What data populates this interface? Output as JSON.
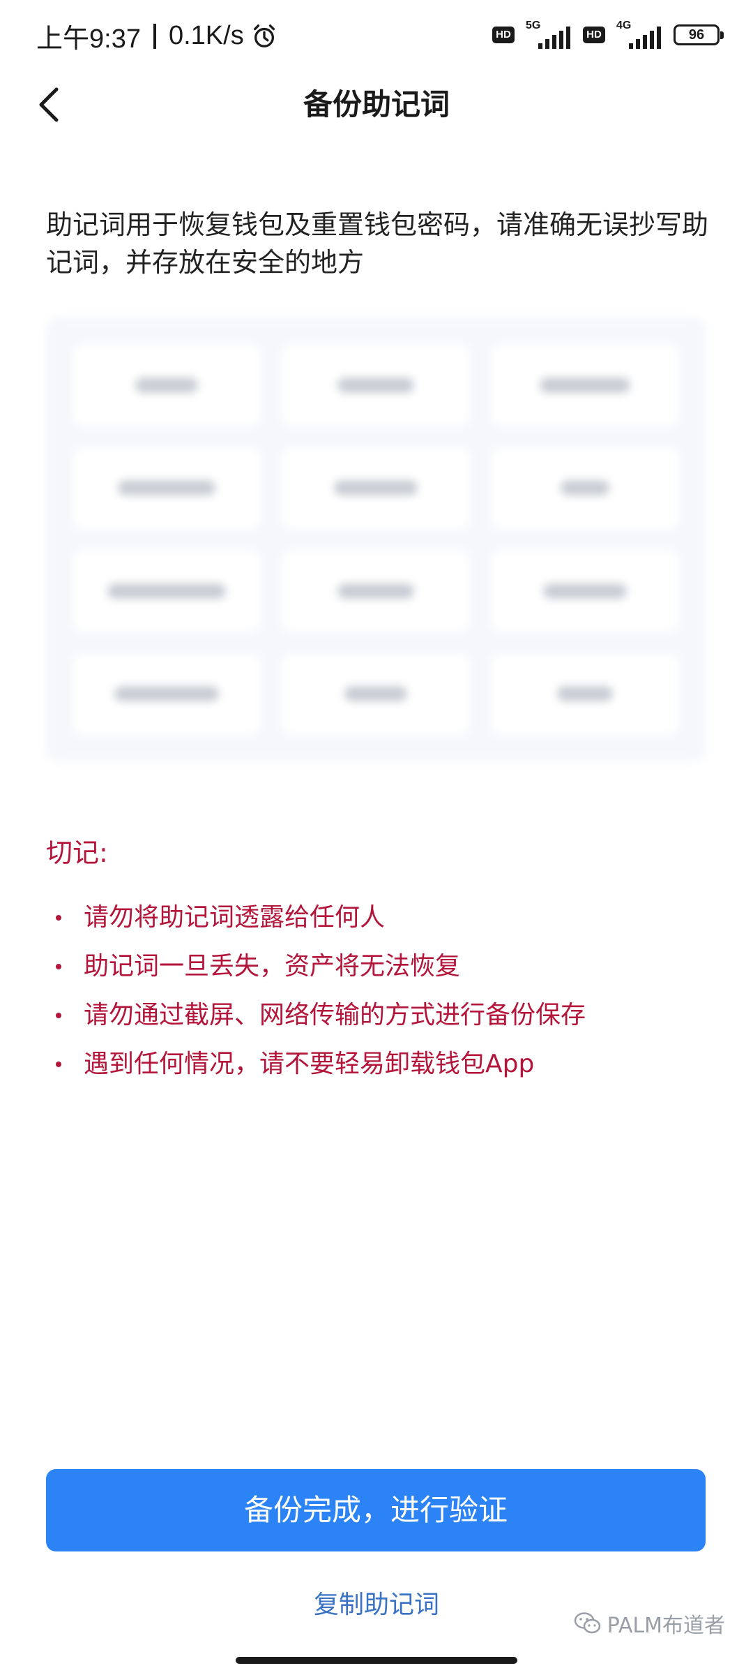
{
  "status_bar": {
    "time": "上午9:37",
    "net_speed": "0.1K/s",
    "hd_label": "HD",
    "net1": "5G",
    "net2": "4G",
    "battery": "96"
  },
  "nav": {
    "title": "备份助记词"
  },
  "description": "助记词用于恢复钱包及重置钱包密码，请准确无误抄写助记词，并存放在安全的地方",
  "mnemonic": {
    "word_count": 12
  },
  "warnings": {
    "heading": "切记:",
    "items": [
      "请勿将助记词透露给任何人",
      "助记词一旦丢失，资产将无法恢复",
      "请勿通过截屏、网络传输的方式进行备份保存",
      "遇到任何情况，请不要轻易卸载钱包App"
    ]
  },
  "actions": {
    "primary_label": "备份完成，进行验证",
    "copy_label": "复制助记词"
  },
  "watermark": "PALM布道者",
  "colors": {
    "primary": "#2b83f6",
    "warning": "#b3163a",
    "link": "#3a72c4"
  }
}
